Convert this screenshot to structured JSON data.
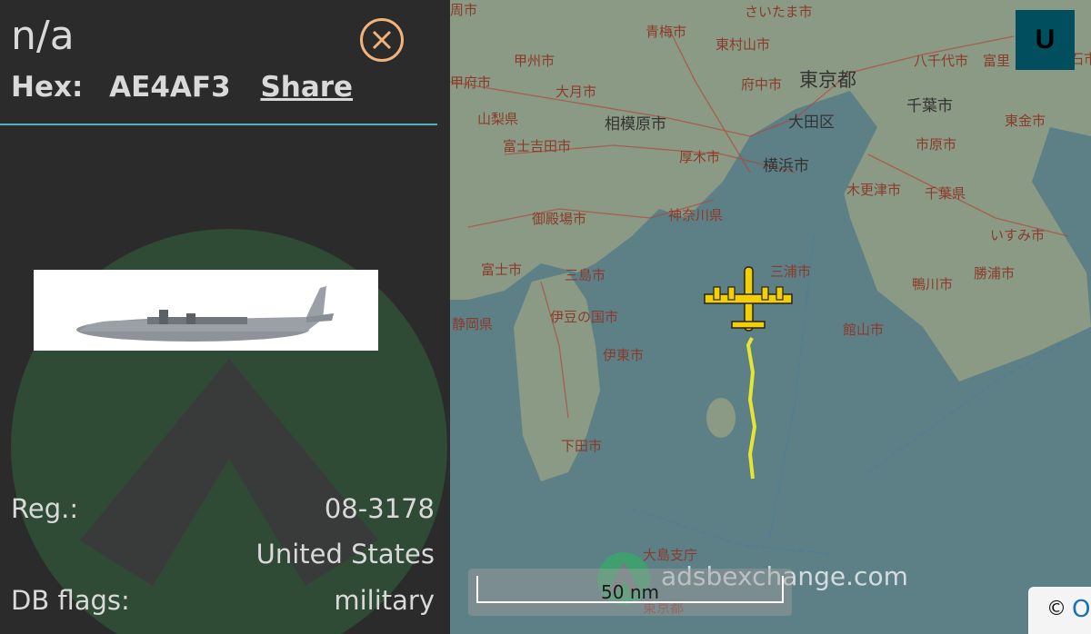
{
  "info_panel": {
    "title": "n/a",
    "hex_label": "Hex:",
    "hex_value": "AE4AF3",
    "share_label": "Share",
    "rows": {
      "reg_label": "Reg.:",
      "reg_value": "08-3178",
      "country_value": "United States",
      "db_flags_label": "DB flags:",
      "db_flags_value": "military"
    }
  },
  "map": {
    "u_button_label": "U",
    "watermark": "adsbexchange.com",
    "scale_label": "50 nm",
    "attribution_symbol": "©",
    "attribution_link": "O",
    "places": [
      "さいたま市",
      "青梅市",
      "東村山市",
      "甲州市",
      "府中市",
      "東京都",
      "八千代市",
      "富里",
      "大月市",
      "山梨県",
      "相模原市",
      "大田区",
      "千葉市",
      "東金市",
      "富士吉田市",
      "厚木市",
      "横浜市",
      "市原市",
      "木更津市",
      "千葉県",
      "御殿場市",
      "神奈川県",
      "いすみ市",
      "富士市",
      "三島市",
      "三浦市",
      "勝浦市",
      "伊豆の国市",
      "鴨川市",
      "静岡県",
      "伊東市",
      "館山市",
      "下田市",
      "大島支庁",
      "東京都",
      "甲府市",
      "石市",
      "周市"
    ]
  },
  "colors": {
    "panel_bg": "#2b2b2b",
    "accent_teal": "#4fb3bf",
    "close_orange": "#f2b27c",
    "aircraft_yellow": "#f5d000",
    "track_yellow": "#e6e632",
    "sea": "#5d7f86",
    "land": "#8a9a84",
    "u_button_bg": "#004e5e"
  },
  "icons": {
    "close": "close-circle-x",
    "aircraft": "four-engine-plane",
    "watermark_logo": "adsbx-logo"
  }
}
